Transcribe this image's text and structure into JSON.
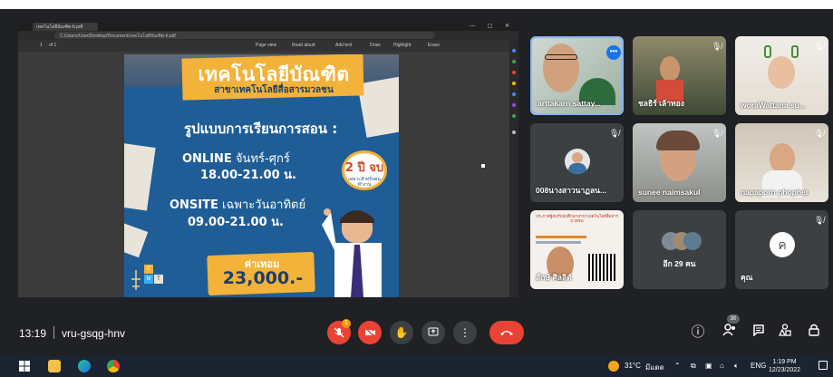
{
  "shared_screen": {
    "browser_tab_title": "เทคโนโลยีบัณฑิต-b.pdf",
    "url": "C:/Users/User/Desktop/Document/เทคโนโลยีบัณฑิต-b.pdf",
    "pdf_toolbar": {
      "page_field": "1",
      "page_total": "of 1",
      "page_view": "Page view",
      "read_aloud": "Read aloud",
      "add_text": "Add text",
      "draw": "Draw",
      "highlight": "Highlight",
      "erase": "Erase"
    },
    "poster": {
      "title": "เทคโนโลยีบัณฑิต",
      "subtitle": "สาขาเทคโนโลยีสื่อสารมวลชน",
      "headline": "รูปแบบการเรียนการสอน :",
      "online_label": "ONLINE",
      "online_days": " จันทร์-ศุกร์",
      "online_time": "18.00-21.00 น.",
      "onsite_label": "ONSITE",
      "onsite_days": " เฉพาะวันอาทิตย์",
      "onsite_time": "09.00-21.00 น.",
      "badge_main": "2 ปี จบ",
      "badge_sub": "เหมาะสำหรับคนทำงาน",
      "price_label": "ค่าเทอม",
      "price": "23,000.-",
      "logo_letters": [
        "C",
        "M",
        "T"
      ]
    }
  },
  "participants": [
    {
      "name": "arttakarn sattay...",
      "muted": false,
      "speaking": true
    },
    {
      "name": "ชลธิร์ เล้าทอง",
      "muted": true
    },
    {
      "name": "woraWattana su...",
      "muted": true
    },
    {
      "name": "008นางสาวนาฏลน...",
      "muted": true
    },
    {
      "name": "sunee naimsakul",
      "muted": true
    },
    {
      "name": "napaporn phophet",
      "muted": true
    },
    {
      "name": "ลักษ์ ศิลลิต์",
      "muted": true,
      "shared_text": "ประกาศผู้สมรับนักศึกษาสาขาเทคโนโลยีสื่อสารมวลชน"
    },
    {
      "name": "อีก 29 คน",
      "muted": false
    },
    {
      "name": "คุณ",
      "muted": true,
      "avatar": "ค"
    }
  ],
  "meeting_bar": {
    "time": "13:19",
    "separator": "|",
    "code": "vru-gsqg-hnv",
    "mic_badge": "1",
    "people_count": "30",
    "icons": [
      "mic-off-icon",
      "camera-off-icon",
      "raise-hand-icon",
      "present-icon",
      "more-options-icon",
      "end-call-icon",
      "info-icon",
      "people-icon",
      "chat-icon",
      "activities-icon",
      "host-controls-icon"
    ]
  },
  "taskbar": {
    "weather": "31°C",
    "weather_desc": "มีแดด",
    "language": "ENG",
    "time": "1:19 PM",
    "date": "12/23/2022"
  }
}
